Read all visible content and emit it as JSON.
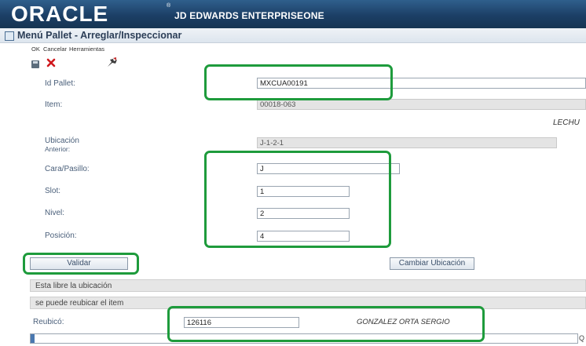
{
  "banner": {
    "oracle": "ORACLE",
    "trademark": "®",
    "product": "JD EDWARDS ENTERPRISEONE"
  },
  "window": {
    "title": "Menú Pallet - Arreglar/Inspeccionar"
  },
  "toolbar": {
    "ok": "OK",
    "cancel": "Cancelar",
    "tools": "Herramientas"
  },
  "form": {
    "pallet_id": {
      "label": "Id Pallet:",
      "value": "MXCUA00191"
    },
    "item": {
      "label": "Item:",
      "value": "00018-063",
      "description": "LECHU"
    },
    "prev_location": {
      "label_line1": "Ubicación",
      "label_line2": "Anterior:",
      "value": "J-1-2-1"
    },
    "aisle": {
      "label": "Cara/Pasillo:",
      "value": "J"
    },
    "slot": {
      "label": "Slot:",
      "value": "1"
    },
    "level": {
      "label": "Nivel:",
      "value": "2"
    },
    "position": {
      "label": "Posición:",
      "value": "4"
    },
    "validate_button": "Validar",
    "change_location_button": "Cambiar Ubicación",
    "message1": "Esta libre la ubicación",
    "message2": "se puede reubicar el item",
    "relocated_by": {
      "label": "Reubicó:",
      "value": "126116",
      "name": "GONZALEZ ORTA SERGIO"
    }
  },
  "footer": {
    "right_char": "Q"
  },
  "colors": {
    "banner": "#1c3f66",
    "highlight": "#1e9b3c",
    "label": "#4a5f7a"
  }
}
